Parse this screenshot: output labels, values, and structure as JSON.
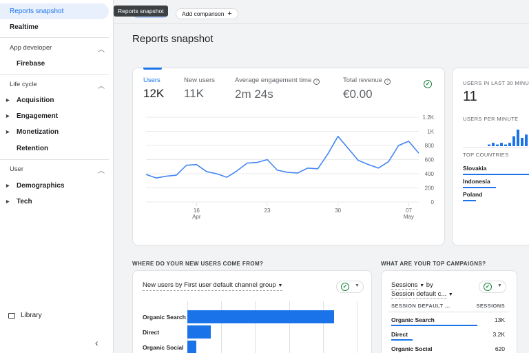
{
  "sidebar": {
    "top_items": [
      {
        "label": "Reports snapshot",
        "active": true
      },
      {
        "label": "Realtime"
      }
    ],
    "sections": [
      {
        "label": "App developer",
        "items": [
          {
            "label": "Firebase"
          }
        ]
      },
      {
        "label": "Life cycle",
        "items": [
          {
            "label": "Acquisition"
          },
          {
            "label": "Engagement"
          },
          {
            "label": "Monetization"
          },
          {
            "label": "Retention"
          }
        ]
      },
      {
        "label": "User",
        "items": [
          {
            "label": "Demographics"
          },
          {
            "label": "Tech"
          }
        ]
      }
    ],
    "library_label": "Library"
  },
  "topbar": {
    "tooltip": "Reports snapshot",
    "add_comparison_label": "Add comparison"
  },
  "page_title": "Reports snapshot",
  "overview": {
    "metrics": [
      {
        "label": "Users",
        "value": "12K",
        "selected": true
      },
      {
        "label": "New users",
        "value": "11K"
      },
      {
        "label": "Average engagement time",
        "value": "2m 24s"
      },
      {
        "label": "Total revenue",
        "value": "€0.00"
      }
    ]
  },
  "chart_data": {
    "type": "line",
    "series": [
      {
        "values": [
          390,
          340,
          365,
          380,
          520,
          530,
          430,
          400,
          350,
          440,
          550,
          560,
          600,
          450,
          420,
          410,
          480,
          470,
          680,
          930,
          760,
          590,
          530,
          480,
          570,
          800,
          860,
          690
        ]
      }
    ],
    "x_ticks": [
      {
        "day": "16",
        "month": "Apr",
        "index": 5
      },
      {
        "day": "23",
        "month": "",
        "index": 12
      },
      {
        "day": "30",
        "month": "",
        "index": 19
      },
      {
        "day": "07",
        "month": "May",
        "index": 26
      }
    ],
    "y_ticks": [
      "1.2K",
      "1K",
      "800",
      "600",
      "400",
      "200",
      "0"
    ],
    "ylim": [
      0,
      1200
    ]
  },
  "realtime": {
    "users_label": "USERS IN LAST 30 MINUT",
    "users_value": "11",
    "per_minute_label": "USERS PER MINUTE",
    "per_minute_bars": [
      1,
      2,
      1,
      2,
      1,
      2,
      6,
      10,
      5,
      7
    ],
    "top_countries_label": "TOP COUNTRIES",
    "countries": [
      {
        "name": "Slovakia",
        "share": 1.0
      },
      {
        "name": "Indonesia",
        "share": 0.5
      },
      {
        "name": "Poland",
        "share": 0.2
      }
    ]
  },
  "new_users": {
    "section_title": "WHERE DO YOUR NEW USERS COME FROM?",
    "dropdown_title": "New users by First user default channel group",
    "channels": [
      {
        "label": "Organic Search",
        "share": 1.0
      },
      {
        "label": "Direct",
        "share": 0.16
      },
      {
        "label": "Organic Social",
        "share": 0.06
      }
    ]
  },
  "campaigns": {
    "section_title": "WHAT ARE YOUR TOP CAMPAIGNS?",
    "dropdown_line1": "Sessions",
    "dropdown_by": "by",
    "dropdown_line2": "Session default c...",
    "col_dimension": "SESSION DEFAULT ...",
    "col_metric": "SESSIONS",
    "rows": [
      {
        "name": "Organic Search",
        "value": "13K",
        "share": 1.0
      },
      {
        "name": "Direct",
        "value": "3.2K",
        "share": 0.25
      },
      {
        "name": "Organic Social",
        "value": "620",
        "share": 0.05
      }
    ]
  }
}
